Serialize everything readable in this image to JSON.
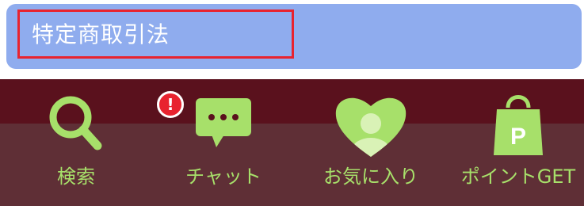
{
  "header": {
    "title": "特定商取引法",
    "highlight_color": "#e8232f",
    "card_color": "#8facee"
  },
  "tabbar": {
    "background_top": "#5a111d",
    "background_bottom": "#5f2f36",
    "accent_color": "#a7e06a",
    "items": [
      {
        "label": "検索",
        "icon": "search-icon"
      },
      {
        "label": "チャット",
        "icon": "chat-bubble-icon",
        "badge": "!"
      },
      {
        "label": "お気に入り",
        "icon": "heart-user-icon"
      },
      {
        "label": "ポイントGET",
        "icon": "points-bag-icon",
        "icon_text": "P"
      }
    ]
  }
}
